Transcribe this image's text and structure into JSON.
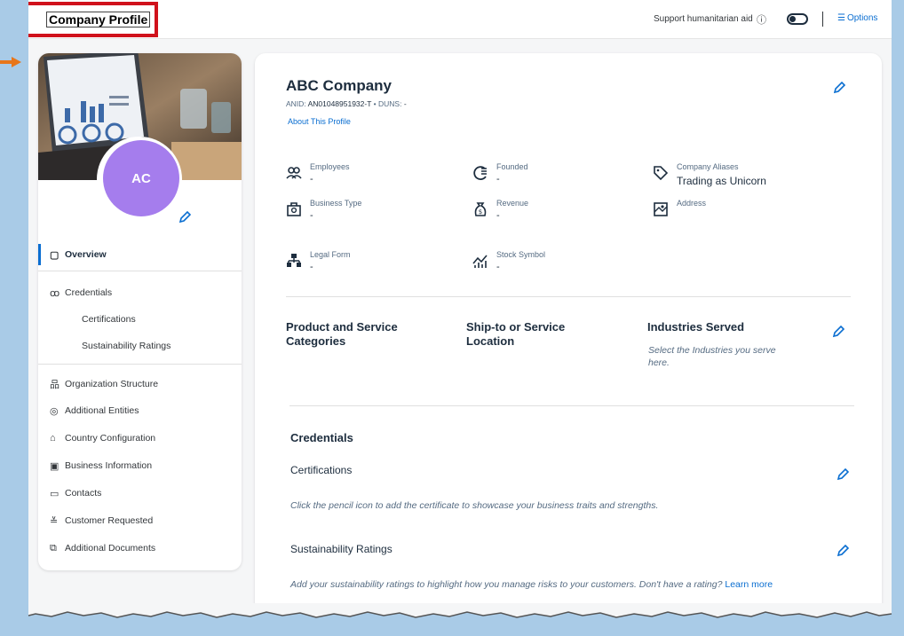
{
  "topbar": {
    "title": "Company Profile",
    "support_text": "Support humanitarian aid",
    "help_glyph": "ⓘ",
    "toggle_state": "off",
    "options_label": "Options"
  },
  "sidebar": {
    "avatar_initials": "AC",
    "items": [
      {
        "label": "Overview",
        "icon": "clipboard-icon",
        "glyph": "▢",
        "active": true
      },
      {
        "label": "Credentials",
        "icon": "user-check-icon",
        "glyph": "ꝏ"
      },
      {
        "label": "Certifications",
        "sub": true
      },
      {
        "label": "Sustainability Ratings",
        "sub": true
      },
      {
        "label": "Organization Structure",
        "icon": "org-chart-icon",
        "glyph": "品"
      },
      {
        "label": "Additional Entities",
        "icon": "entities-icon",
        "glyph": "◎"
      },
      {
        "label": "Country Configuration",
        "icon": "bank-icon",
        "glyph": "⌂"
      },
      {
        "label": "Business Information",
        "icon": "business-info-icon",
        "glyph": "▣"
      },
      {
        "label": "Contacts",
        "icon": "contact-card-icon",
        "glyph": "▭"
      },
      {
        "label": "Customer Requested",
        "icon": "checklist-icon",
        "glyph": "≚"
      },
      {
        "label": "Additional Documents",
        "icon": "documents-icon",
        "glyph": "⧉"
      }
    ]
  },
  "company": {
    "name": "ABC Company",
    "anid_label": "ANID:",
    "anid_value": "AN01048951932-T",
    "separator": "•",
    "duns_label": "DUNS:",
    "duns_value": "-",
    "about_link": "About This Profile"
  },
  "fields": {
    "employees": {
      "label": "Employees",
      "value": "-",
      "icon": "employees-icon"
    },
    "founded": {
      "label": "Founded",
      "value": "-",
      "icon": "calendar-icon"
    },
    "aliases": {
      "label": "Company Aliases",
      "value": "Trading as Unicorn",
      "icon": "tag-icon"
    },
    "business_type": {
      "label": "Business Type",
      "value": "-",
      "icon": "business-type-icon"
    },
    "revenue": {
      "label": "Revenue",
      "value": "-",
      "icon": "money-bag-icon"
    },
    "address": {
      "label": "Address",
      "value": "",
      "icon": "map-icon"
    },
    "legal_form": {
      "label": "Legal Form",
      "value": "-",
      "icon": "hierarchy-icon"
    },
    "stock_symbol": {
      "label": "Stock Symbol",
      "value": "-",
      "icon": "stock-chart-icon"
    }
  },
  "sections": {
    "products": "Product and Service Categories",
    "ship_to": "Ship-to or Service Location",
    "industries": "Industries Served",
    "industries_note": "Select the Industries you serve here."
  },
  "credentials": {
    "title": "Credentials",
    "certifications_title": "Certifications",
    "certifications_note": "Click the pencil icon to add the certificate to showcase your business traits and strengths.",
    "sustainability_title": "Sustainability Ratings",
    "sustainability_note": "Add your sustainability ratings to highlight how you manage risks to your customers. Don't have a rating?",
    "learn_more": "Learn more"
  },
  "colors": {
    "accent": "#0a6ed1",
    "highlight_box": "#d0111b",
    "avatar": "#a57ded",
    "backdrop": "#a9cbe7",
    "marker_arrow": "#e8761a"
  }
}
